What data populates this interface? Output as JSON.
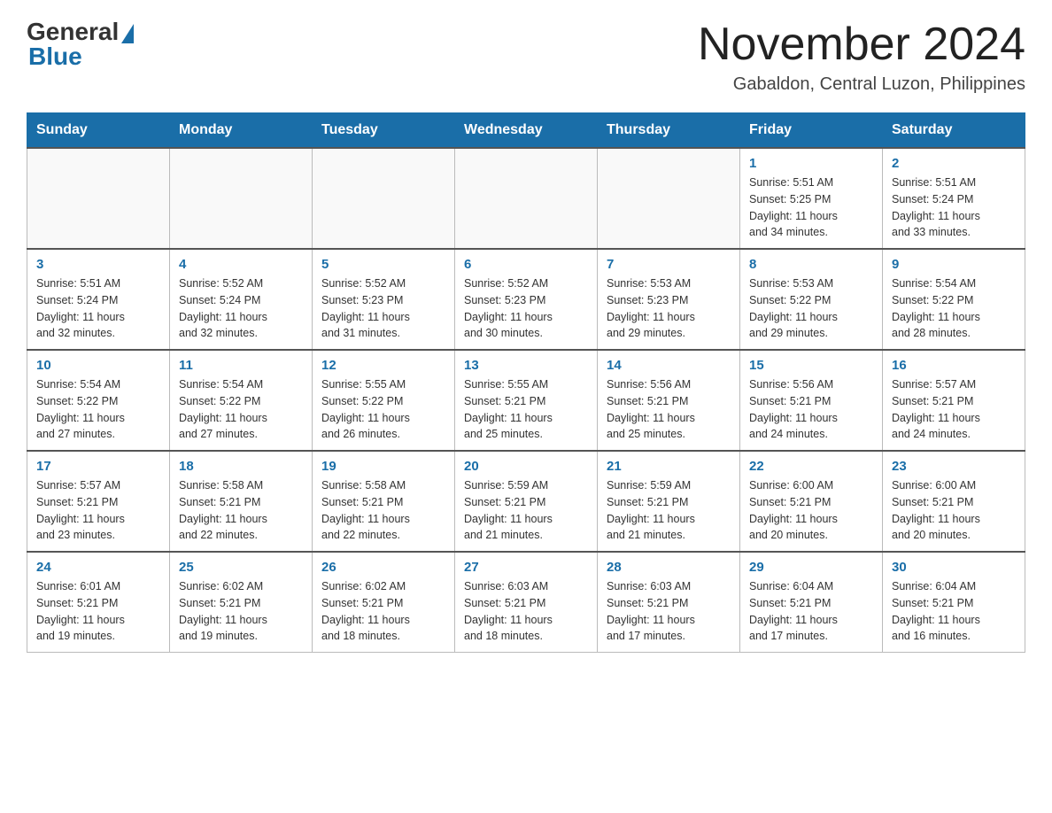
{
  "header": {
    "logo_general": "General",
    "logo_blue": "Blue",
    "month_title": "November 2024",
    "location": "Gabaldon, Central Luzon, Philippines"
  },
  "days_of_week": [
    "Sunday",
    "Monday",
    "Tuesday",
    "Wednesday",
    "Thursday",
    "Friday",
    "Saturday"
  ],
  "weeks": [
    [
      {
        "day": "",
        "info": ""
      },
      {
        "day": "",
        "info": ""
      },
      {
        "day": "",
        "info": ""
      },
      {
        "day": "",
        "info": ""
      },
      {
        "day": "",
        "info": ""
      },
      {
        "day": "1",
        "info": "Sunrise: 5:51 AM\nSunset: 5:25 PM\nDaylight: 11 hours\nand 34 minutes."
      },
      {
        "day": "2",
        "info": "Sunrise: 5:51 AM\nSunset: 5:24 PM\nDaylight: 11 hours\nand 33 minutes."
      }
    ],
    [
      {
        "day": "3",
        "info": "Sunrise: 5:51 AM\nSunset: 5:24 PM\nDaylight: 11 hours\nand 32 minutes."
      },
      {
        "day": "4",
        "info": "Sunrise: 5:52 AM\nSunset: 5:24 PM\nDaylight: 11 hours\nand 32 minutes."
      },
      {
        "day": "5",
        "info": "Sunrise: 5:52 AM\nSunset: 5:23 PM\nDaylight: 11 hours\nand 31 minutes."
      },
      {
        "day": "6",
        "info": "Sunrise: 5:52 AM\nSunset: 5:23 PM\nDaylight: 11 hours\nand 30 minutes."
      },
      {
        "day": "7",
        "info": "Sunrise: 5:53 AM\nSunset: 5:23 PM\nDaylight: 11 hours\nand 29 minutes."
      },
      {
        "day": "8",
        "info": "Sunrise: 5:53 AM\nSunset: 5:22 PM\nDaylight: 11 hours\nand 29 minutes."
      },
      {
        "day": "9",
        "info": "Sunrise: 5:54 AM\nSunset: 5:22 PM\nDaylight: 11 hours\nand 28 minutes."
      }
    ],
    [
      {
        "day": "10",
        "info": "Sunrise: 5:54 AM\nSunset: 5:22 PM\nDaylight: 11 hours\nand 27 minutes."
      },
      {
        "day": "11",
        "info": "Sunrise: 5:54 AM\nSunset: 5:22 PM\nDaylight: 11 hours\nand 27 minutes."
      },
      {
        "day": "12",
        "info": "Sunrise: 5:55 AM\nSunset: 5:22 PM\nDaylight: 11 hours\nand 26 minutes."
      },
      {
        "day": "13",
        "info": "Sunrise: 5:55 AM\nSunset: 5:21 PM\nDaylight: 11 hours\nand 25 minutes."
      },
      {
        "day": "14",
        "info": "Sunrise: 5:56 AM\nSunset: 5:21 PM\nDaylight: 11 hours\nand 25 minutes."
      },
      {
        "day": "15",
        "info": "Sunrise: 5:56 AM\nSunset: 5:21 PM\nDaylight: 11 hours\nand 24 minutes."
      },
      {
        "day": "16",
        "info": "Sunrise: 5:57 AM\nSunset: 5:21 PM\nDaylight: 11 hours\nand 24 minutes."
      }
    ],
    [
      {
        "day": "17",
        "info": "Sunrise: 5:57 AM\nSunset: 5:21 PM\nDaylight: 11 hours\nand 23 minutes."
      },
      {
        "day": "18",
        "info": "Sunrise: 5:58 AM\nSunset: 5:21 PM\nDaylight: 11 hours\nand 22 minutes."
      },
      {
        "day": "19",
        "info": "Sunrise: 5:58 AM\nSunset: 5:21 PM\nDaylight: 11 hours\nand 22 minutes."
      },
      {
        "day": "20",
        "info": "Sunrise: 5:59 AM\nSunset: 5:21 PM\nDaylight: 11 hours\nand 21 minutes."
      },
      {
        "day": "21",
        "info": "Sunrise: 5:59 AM\nSunset: 5:21 PM\nDaylight: 11 hours\nand 21 minutes."
      },
      {
        "day": "22",
        "info": "Sunrise: 6:00 AM\nSunset: 5:21 PM\nDaylight: 11 hours\nand 20 minutes."
      },
      {
        "day": "23",
        "info": "Sunrise: 6:00 AM\nSunset: 5:21 PM\nDaylight: 11 hours\nand 20 minutes."
      }
    ],
    [
      {
        "day": "24",
        "info": "Sunrise: 6:01 AM\nSunset: 5:21 PM\nDaylight: 11 hours\nand 19 minutes."
      },
      {
        "day": "25",
        "info": "Sunrise: 6:02 AM\nSunset: 5:21 PM\nDaylight: 11 hours\nand 19 minutes."
      },
      {
        "day": "26",
        "info": "Sunrise: 6:02 AM\nSunset: 5:21 PM\nDaylight: 11 hours\nand 18 minutes."
      },
      {
        "day": "27",
        "info": "Sunrise: 6:03 AM\nSunset: 5:21 PM\nDaylight: 11 hours\nand 18 minutes."
      },
      {
        "day": "28",
        "info": "Sunrise: 6:03 AM\nSunset: 5:21 PM\nDaylight: 11 hours\nand 17 minutes."
      },
      {
        "day": "29",
        "info": "Sunrise: 6:04 AM\nSunset: 5:21 PM\nDaylight: 11 hours\nand 17 minutes."
      },
      {
        "day": "30",
        "info": "Sunrise: 6:04 AM\nSunset: 5:21 PM\nDaylight: 11 hours\nand 16 minutes."
      }
    ]
  ]
}
